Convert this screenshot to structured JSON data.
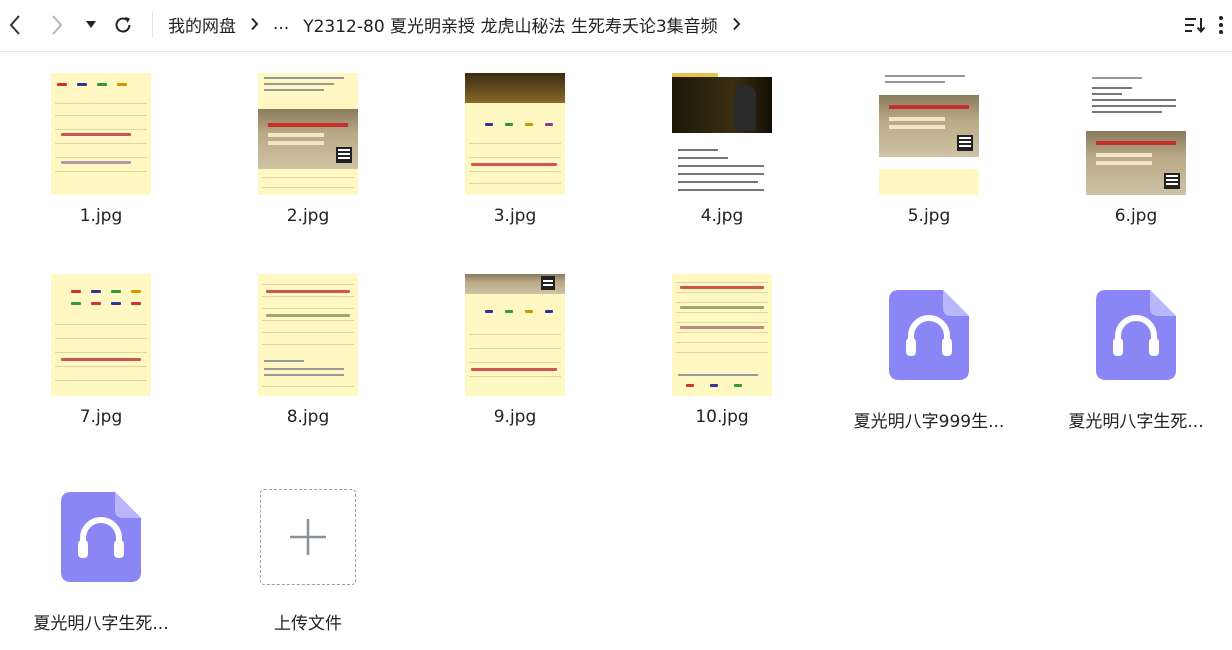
{
  "toolbar": {
    "breadcrumb": {
      "root": "我的网盘",
      "ellipsis": "...",
      "current": "Y2312-80 夏光明亲授 龙虎山秘法 生死寿夭论3集音频"
    }
  },
  "colors": {
    "audio_icon": "#8b86f5",
    "audio_fold": "#b9b6fb",
    "image_sheet": "#fff8c2"
  },
  "files": [
    {
      "name": "1.jpg",
      "kind": "image",
      "icon": "image-thumbnail"
    },
    {
      "name": "2.jpg",
      "kind": "image",
      "icon": "image-thumbnail"
    },
    {
      "name": "3.jpg",
      "kind": "image",
      "icon": "image-thumbnail"
    },
    {
      "name": "4.jpg",
      "kind": "image",
      "icon": "image-thumbnail"
    },
    {
      "name": "5.jpg",
      "kind": "image",
      "icon": "image-thumbnail"
    },
    {
      "name": "6.jpg",
      "kind": "image",
      "icon": "image-thumbnail"
    },
    {
      "name": "7.jpg",
      "kind": "image",
      "icon": "image-thumbnail"
    },
    {
      "name": "8.jpg",
      "kind": "image",
      "icon": "image-thumbnail"
    },
    {
      "name": "9.jpg",
      "kind": "image",
      "icon": "image-thumbnail"
    },
    {
      "name": "10.jpg",
      "kind": "image",
      "icon": "image-thumbnail"
    },
    {
      "name": "夏光明八字999生...",
      "kind": "audio",
      "icon": "headphones-icon"
    },
    {
      "name": "夏光明八字生死...",
      "kind": "audio",
      "icon": "headphones-icon"
    },
    {
      "name": "夏光明八字生死...",
      "kind": "audio",
      "icon": "headphones-icon"
    }
  ],
  "upload": {
    "label": "上传文件",
    "icon": "plus-icon"
  }
}
